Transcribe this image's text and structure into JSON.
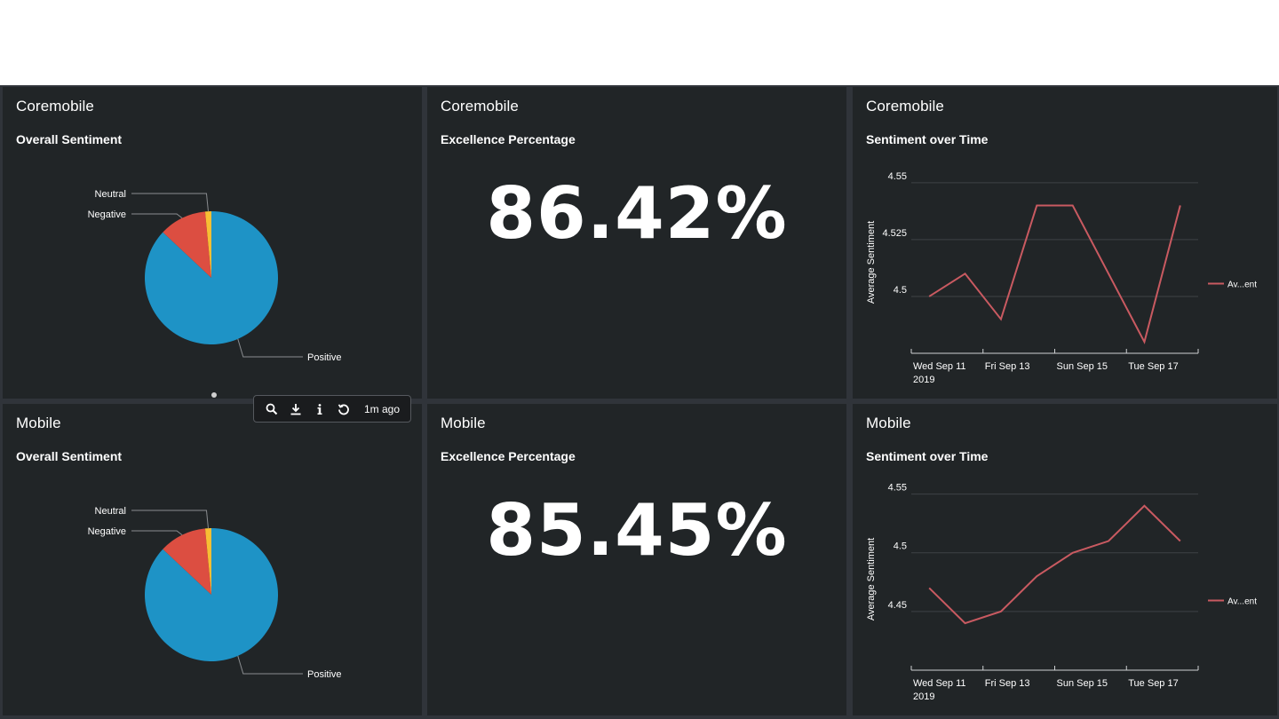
{
  "panels": {
    "p1": {
      "group": "Coremobile",
      "title": "Overall Sentiment"
    },
    "p2": {
      "group": "Coremobile",
      "title": "Excellence Percentage",
      "value": "86.42%"
    },
    "p3": {
      "group": "Coremobile",
      "title": "Sentiment over Time"
    },
    "p4": {
      "group": "Mobile",
      "title": "Overall Sentiment"
    },
    "p5": {
      "group": "Mobile",
      "title": "Excellence Percentage",
      "value": "85.45%"
    },
    "p6": {
      "group": "Mobile",
      "title": "Sentiment over Time"
    }
  },
  "toolbar": {
    "icons": [
      "search-icon",
      "download-icon",
      "info-icon",
      "refresh-icon"
    ],
    "time_label": "1m ago"
  },
  "colors": {
    "positive": "#1e93c6",
    "negative": "#dc4e41",
    "neutral": "#f8be34",
    "line": "#c95a61",
    "panel_bg": "#212527",
    "dashboard_bg": "#30343a"
  },
  "chart_data": [
    {
      "type": "pie",
      "title": "Overall Sentiment",
      "categories": [
        "Positive",
        "Negative",
        "Neutral"
      ],
      "values": [
        87,
        11.5,
        1.5
      ]
    },
    {
      "type": "line",
      "title": "Sentiment over Time",
      "ylabel": "Average Sentiment",
      "x": [
        "2019-09-11",
        "2019-09-12",
        "2019-09-13",
        "2019-09-14",
        "2019-09-15",
        "2019-09-16",
        "2019-09-17",
        "2019-09-18"
      ],
      "x_tick_labels": [
        "Wed Sep 11",
        "Fri Sep 13",
        "Sun Sep 15",
        "Tue Sep 17"
      ],
      "x_tick_sub": "2019",
      "series": [
        {
          "name": "Av...ent",
          "values": [
            4.5,
            4.51,
            4.49,
            4.54,
            4.54,
            4.51,
            4.48,
            4.54
          ]
        }
      ],
      "y_ticks": [
        "4.55",
        "4.525",
        "4.5"
      ],
      "ylim": [
        4.475,
        4.555
      ],
      "grid": true,
      "legend": "right"
    },
    {
      "type": "pie",
      "title": "Overall Sentiment",
      "categories": [
        "Positive",
        "Negative",
        "Neutral"
      ],
      "values": [
        87,
        11.5,
        1.5
      ]
    },
    {
      "type": "line",
      "title": "Sentiment over Time",
      "ylabel": "Average Sentiment",
      "x": [
        "2019-09-11",
        "2019-09-12",
        "2019-09-13",
        "2019-09-14",
        "2019-09-15",
        "2019-09-16",
        "2019-09-17",
        "2019-09-18"
      ],
      "x_tick_labels": [
        "Wed Sep 11",
        "Fri Sep 13",
        "Sun Sep 15",
        "Tue Sep 17"
      ],
      "x_tick_sub": "2019",
      "series": [
        {
          "name": "Av...ent",
          "values": [
            4.47,
            4.44,
            4.45,
            4.48,
            4.5,
            4.51,
            4.54,
            4.51
          ]
        }
      ],
      "y_ticks": [
        "4.55",
        "4.5",
        "4.45"
      ],
      "ylim": [
        4.4,
        4.555
      ],
      "grid": true,
      "legend": "right"
    }
  ]
}
